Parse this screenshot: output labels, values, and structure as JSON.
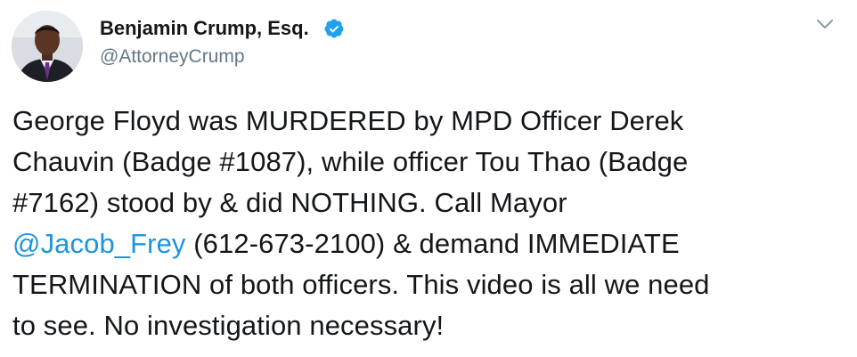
{
  "author": {
    "display_name": "Benjamin Crump, Esq.",
    "handle": "@AttorneyCrump",
    "verified": true,
    "avatar_icon": "avatar-photo"
  },
  "tweet": {
    "text_before_mention": "George Floyd was MURDERED by MPD Officer Derek\nChauvin (Badge #1087), while officer Tou Thao (Badge\n#7162) stood by & did NOTHING. Call Mayor\n",
    "mention": "@Jacob_Frey",
    "text_after_mention": " (612-673-2100) & demand IMMEDIATE\nTERMINATION of both officers. This video is all we need\nto see. No investigation necessary!"
  },
  "icons": {
    "verified": "verified-badge-icon",
    "menu": "chevron-down-icon"
  },
  "colors": {
    "text": "#14171a",
    "secondary": "#657786",
    "link": "#1b95e0",
    "verified": "#1da1f2"
  }
}
